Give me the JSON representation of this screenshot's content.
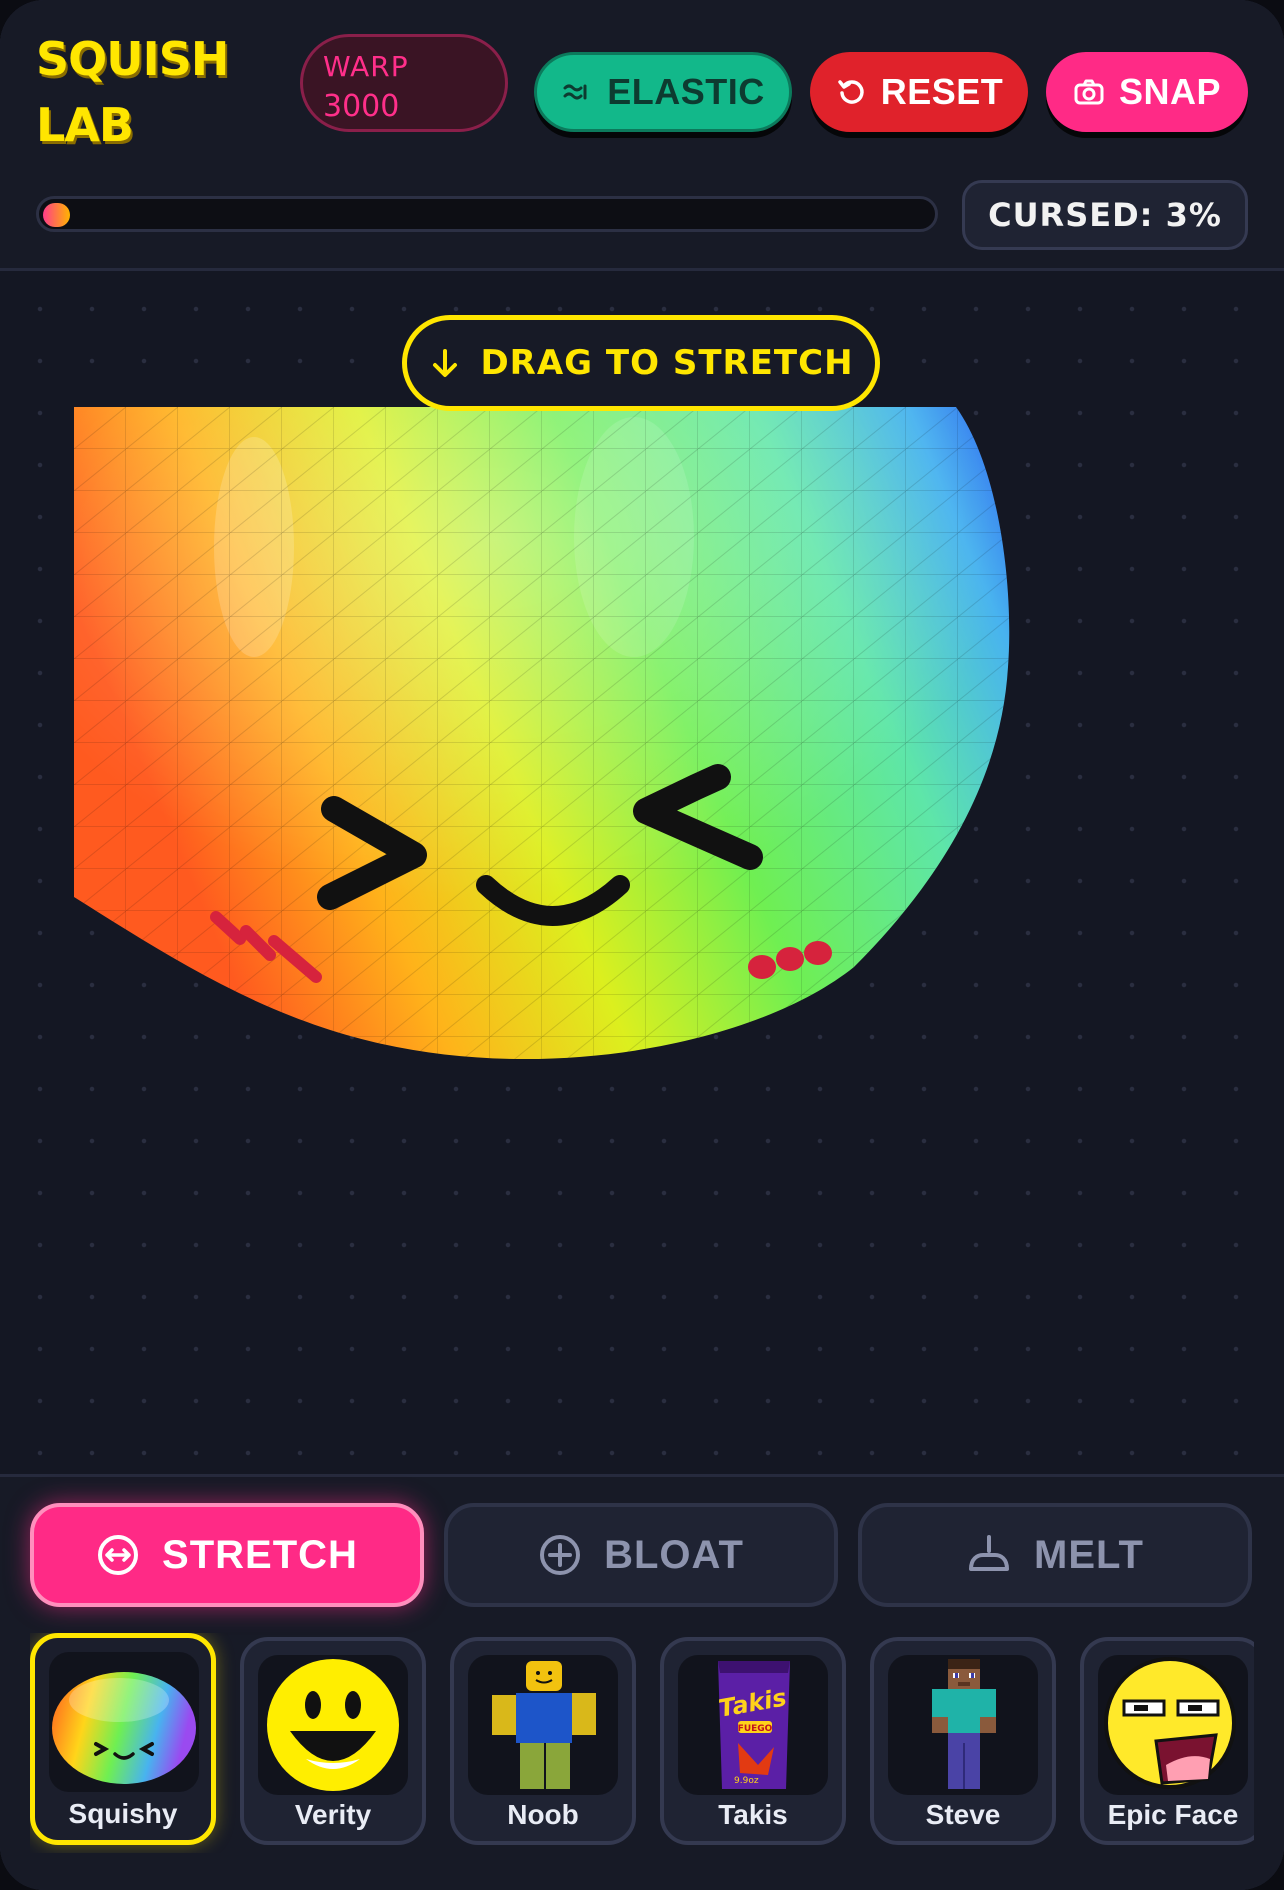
{
  "app": {
    "brand": "SQUISH LAB",
    "brand_line1": "SQUISH",
    "brand_line2": "LAB",
    "accent": "#ffe600"
  },
  "header": {
    "warp_label": "WARP",
    "warp_value": "3000",
    "buttons": {
      "elastic": {
        "label": "ELASTIC",
        "icon": "wave-icon",
        "color": "#12b88a"
      },
      "reset": {
        "label": "RESET",
        "icon": "reset-icon",
        "color": "#e0222b"
      },
      "snap": {
        "label": "SNAP",
        "icon": "camera-icon",
        "color": "#ff2a86"
      }
    },
    "progress_fraction": 0.03,
    "cursed_label": "CURSED: 3%"
  },
  "stage": {
    "hint": "DRAG TO STRETCH",
    "hint_icon": "arrow-down-icon",
    "subject": "Squishy"
  },
  "modes": [
    {
      "label": "STRETCH",
      "icon": "stretch-icon",
      "active": true
    },
    {
      "label": "BLOAT",
      "icon": "plus-circle-icon",
      "active": false
    },
    {
      "label": "MELT",
      "icon": "melt-icon",
      "active": false
    }
  ],
  "presets": [
    {
      "name": "Squishy",
      "selected": true
    },
    {
      "name": "Verity",
      "selected": false
    },
    {
      "name": "Noob",
      "selected": false
    },
    {
      "name": "Takis",
      "selected": false
    },
    {
      "name": "Steve",
      "selected": false
    },
    {
      "name": "Epic Face",
      "selected": false
    }
  ],
  "takis_thumb": {
    "brand": "Takis",
    "flavor": "FUEGO",
    "size": "9.9oz"
  }
}
